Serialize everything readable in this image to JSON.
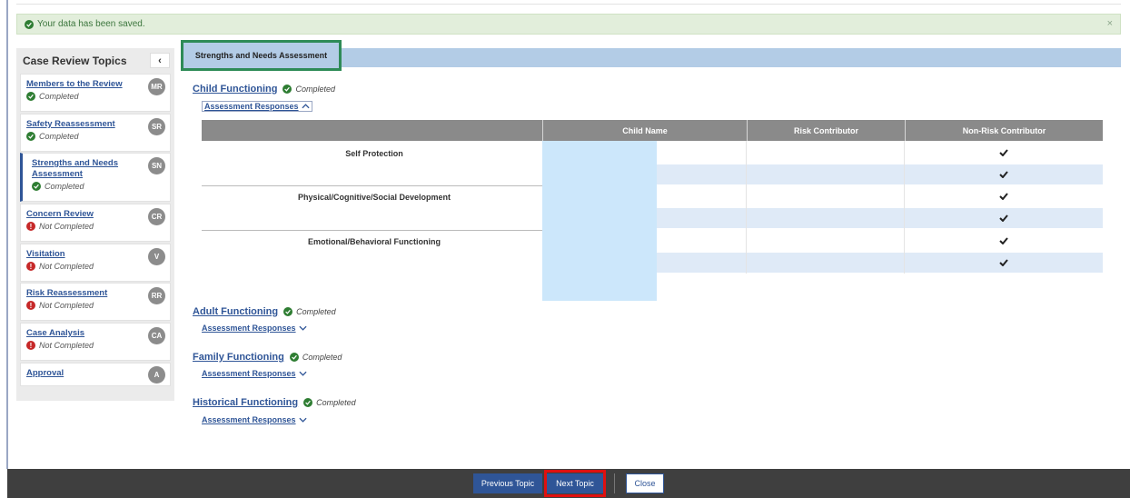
{
  "alert": {
    "message": "Your data has been saved.",
    "close": "×"
  },
  "sidebar": {
    "title": "Case Review Topics",
    "collapse": "‹",
    "items": [
      {
        "label": "Members to the Review",
        "status": "Completed",
        "badge": "MR"
      },
      {
        "label": "Safety Reassessment",
        "status": "Completed",
        "badge": "SR"
      },
      {
        "label": "Strengths and Needs Assessment",
        "status": "Completed",
        "badge": "SN"
      },
      {
        "label": "Concern Review",
        "status": "Not Completed",
        "badge": "CR"
      },
      {
        "label": "Visitation",
        "status": "Not Completed",
        "badge": "V"
      },
      {
        "label": "Risk Reassessment",
        "status": "Not Completed",
        "badge": "RR"
      },
      {
        "label": "Case Analysis",
        "status": "Not Completed",
        "badge": "CA"
      },
      {
        "label": "Approval",
        "status": "",
        "badge": "A"
      }
    ]
  },
  "section": {
    "title": "Strengths and Needs Assessment"
  },
  "functioning": [
    {
      "label": "Child Functioning",
      "status": "Completed",
      "responses": "Assessment Responses"
    },
    {
      "label": "Adult Functioning",
      "status": "Completed",
      "responses": "Assessment Responses"
    },
    {
      "label": "Family Functioning",
      "status": "Completed",
      "responses": "Assessment Responses"
    },
    {
      "label": "Historical Functioning",
      "status": "Completed",
      "responses": "Assessment Responses"
    }
  ],
  "table": {
    "columns": [
      "Child Name",
      "Risk Contributor",
      "Non-Risk Contributor"
    ],
    "rows": [
      "Self Protection",
      "Physical/Cognitive/Social Development",
      "Emotional/Behavioral Functioning"
    ]
  },
  "footer": {
    "previous": "Previous Topic",
    "next": "Next Topic",
    "close": "Close"
  },
  "colors": {
    "link": "#2f5597",
    "completed": "#2e7d32",
    "not_completed": "#c62828",
    "highlight_green": "#2e8b57",
    "highlight_red": "#e01010",
    "band": "#b3cce6"
  }
}
